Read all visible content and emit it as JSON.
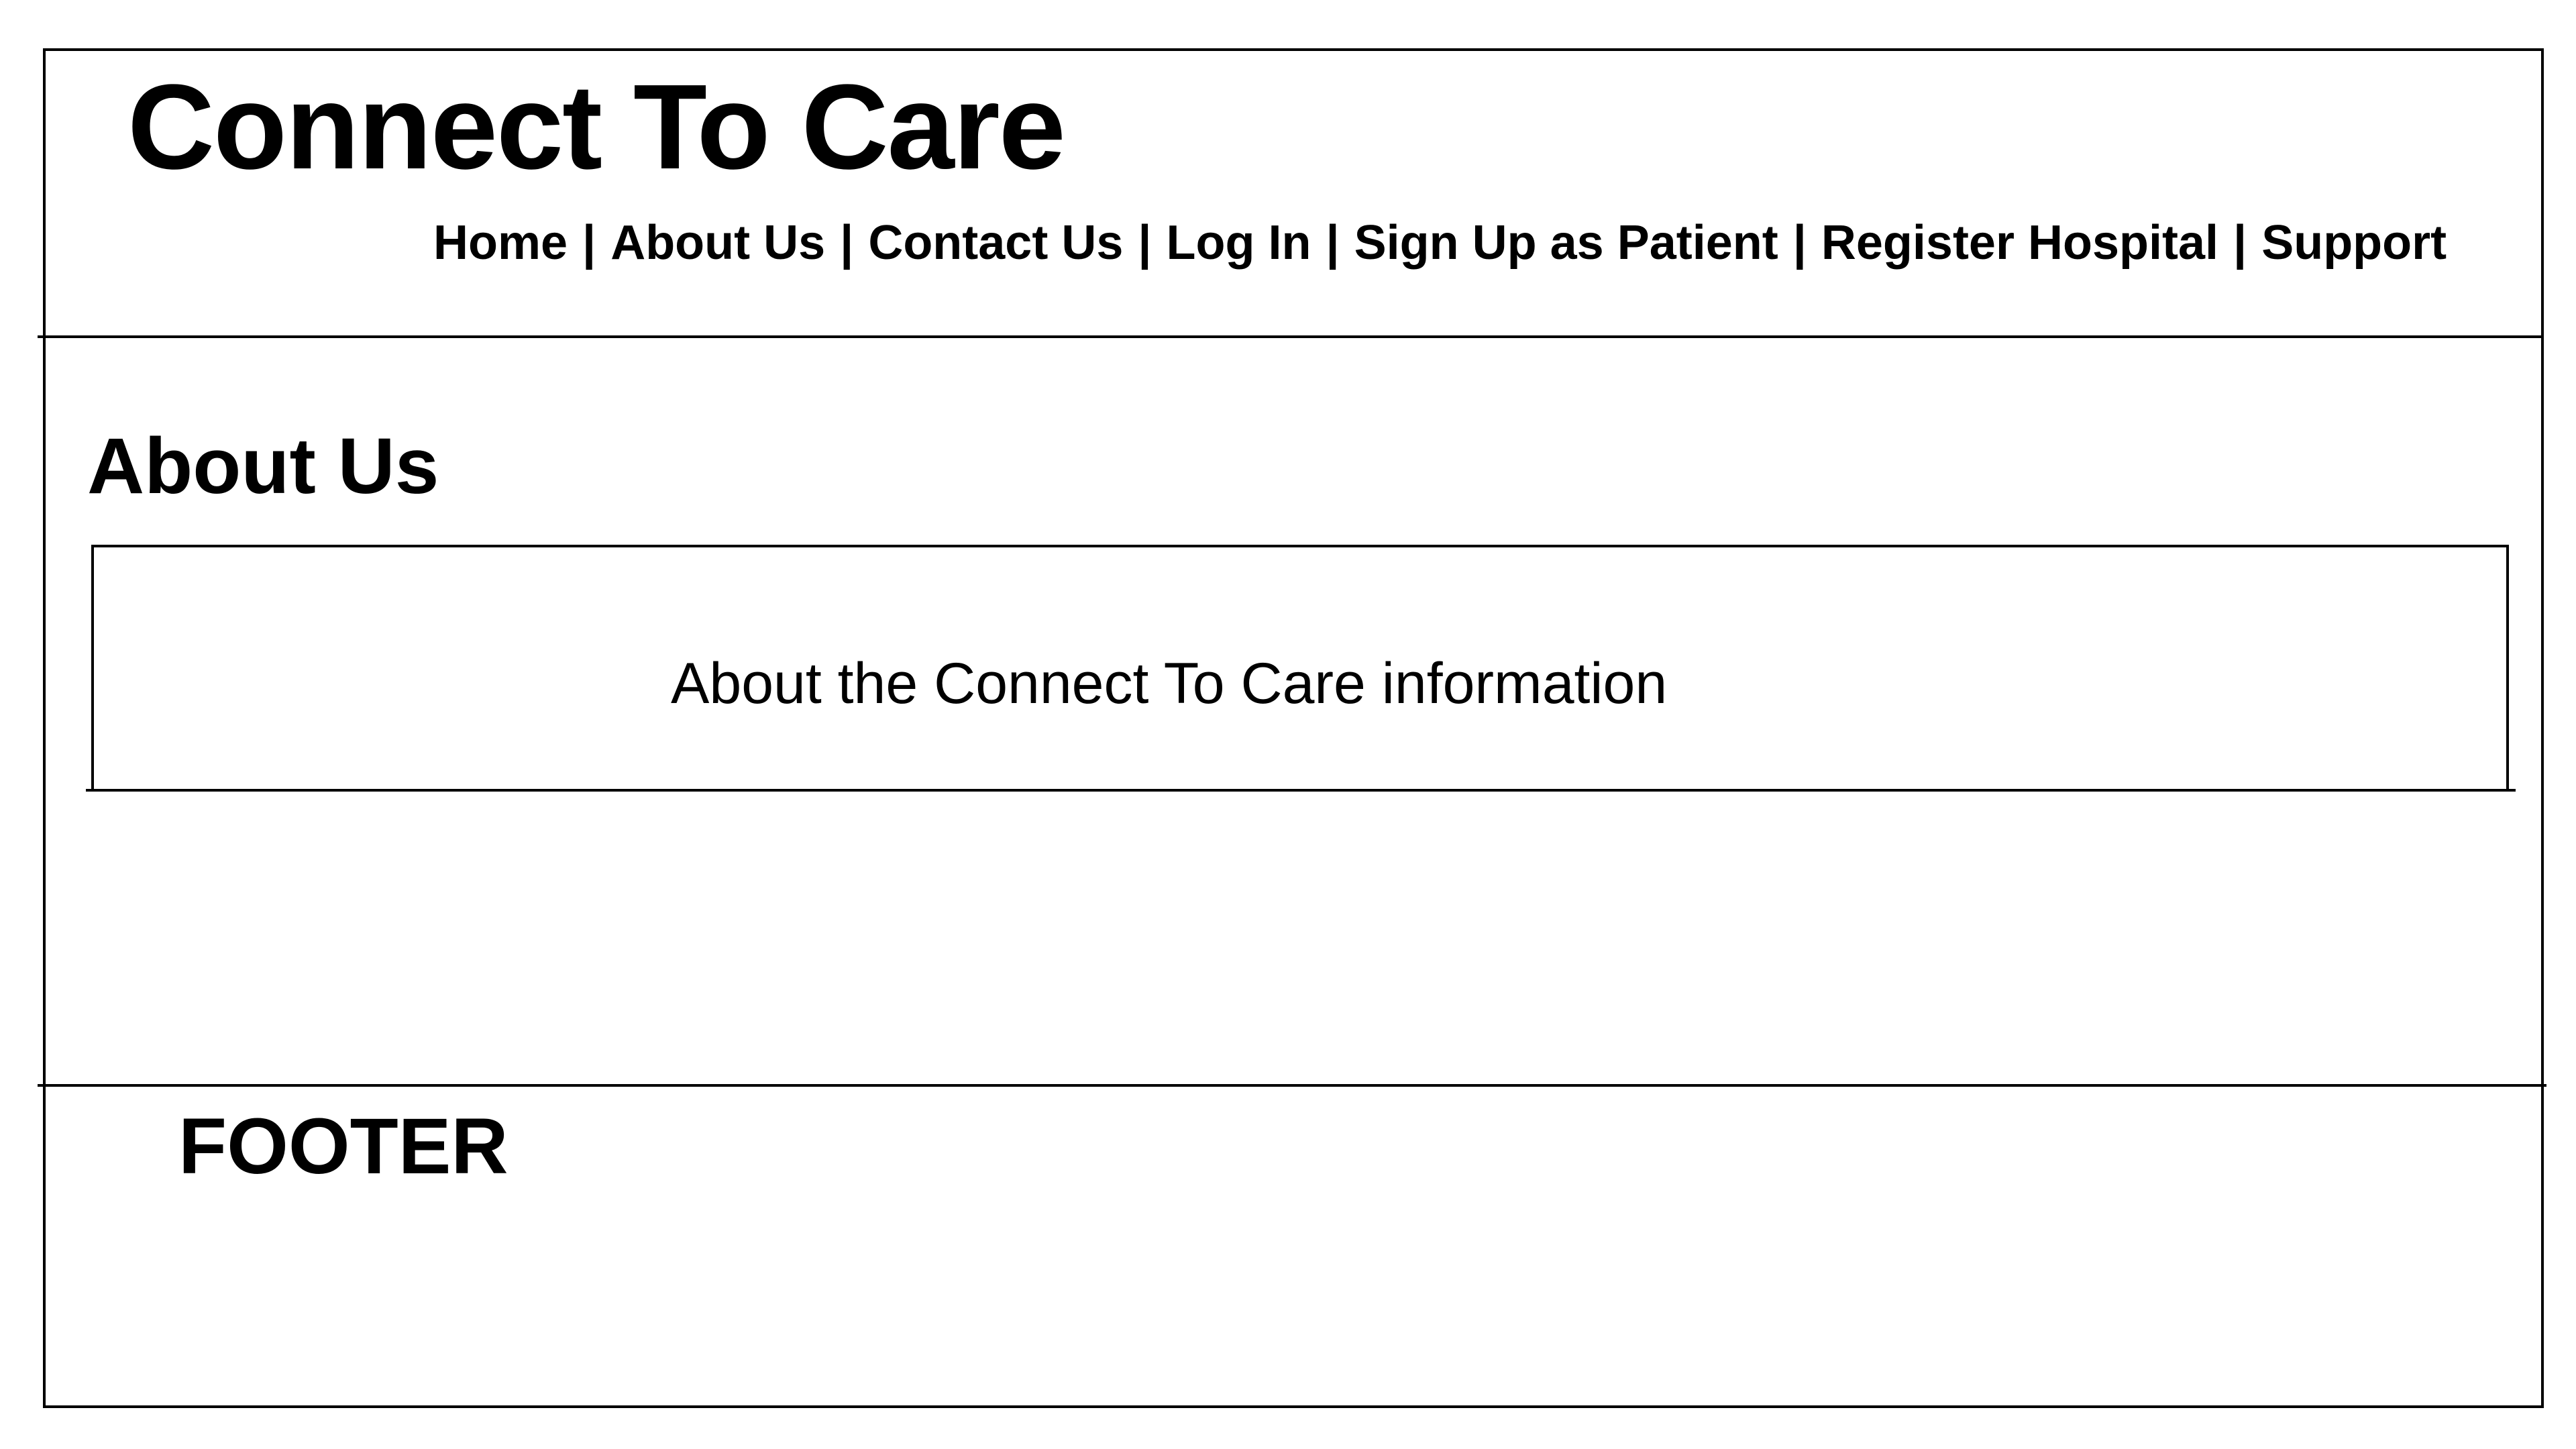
{
  "header": {
    "logo_text": "Connect To Care",
    "nav": {
      "items": [
        {
          "label": "Home"
        },
        {
          "label": "About Us"
        },
        {
          "label": "Contact Us"
        },
        {
          "label": "Log In"
        },
        {
          "label": "Sign Up as Patient"
        },
        {
          "label": "Register Hospital"
        },
        {
          "label": "Support"
        }
      ],
      "separator": "|"
    }
  },
  "main": {
    "title": "About Us",
    "info_text": "About the Connect To Care information"
  },
  "footer": {
    "label": "FOOTER"
  },
  "colors": {
    "background": "#ffffff",
    "foreground": "#000000"
  }
}
